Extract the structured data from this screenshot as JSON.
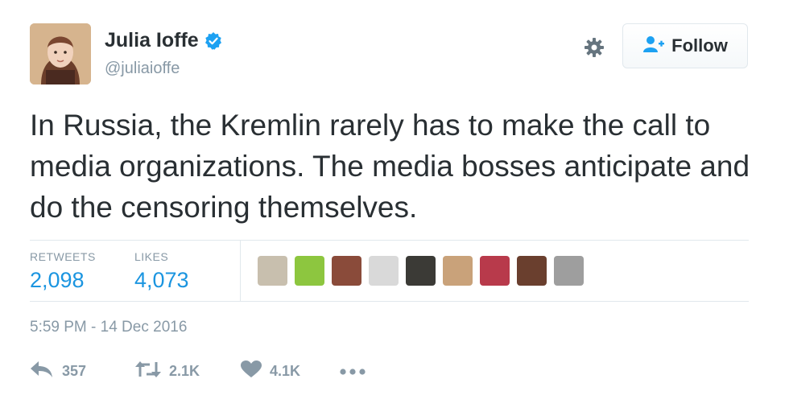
{
  "user": {
    "display_name": "Julia Ioffe",
    "handle": "@juliaioffe",
    "verified": true
  },
  "header": {
    "follow_label": "Follow"
  },
  "tweet": {
    "text": "In Russia, the Kremlin rarely has to make the call to media organizations. The media bosses anticipate and do the censoring themselves.",
    "timestamp": "5:59 PM - 14 Dec 2016"
  },
  "stats": {
    "retweets_label": "RETWEETS",
    "retweets_value": "2,098",
    "likes_label": "LIKES",
    "likes_value": "4,073"
  },
  "likers": [
    {
      "color": "#c8bfae"
    },
    {
      "color": "#8dc63f"
    },
    {
      "color": "#8a4b3a"
    },
    {
      "color": "#d9d9d9"
    },
    {
      "color": "#3b3a36"
    },
    {
      "color": "#c9a27a"
    },
    {
      "color": "#b83a4b"
    },
    {
      "color": "#6a3f2e"
    },
    {
      "color": "#9e9e9e"
    }
  ],
  "actions": {
    "reply_count": "357",
    "retweet_count": "2.1K",
    "like_count": "4.1K"
  },
  "colors": {
    "accent": "#1b95e0",
    "muted": "#8899a6",
    "text": "#292f33"
  }
}
